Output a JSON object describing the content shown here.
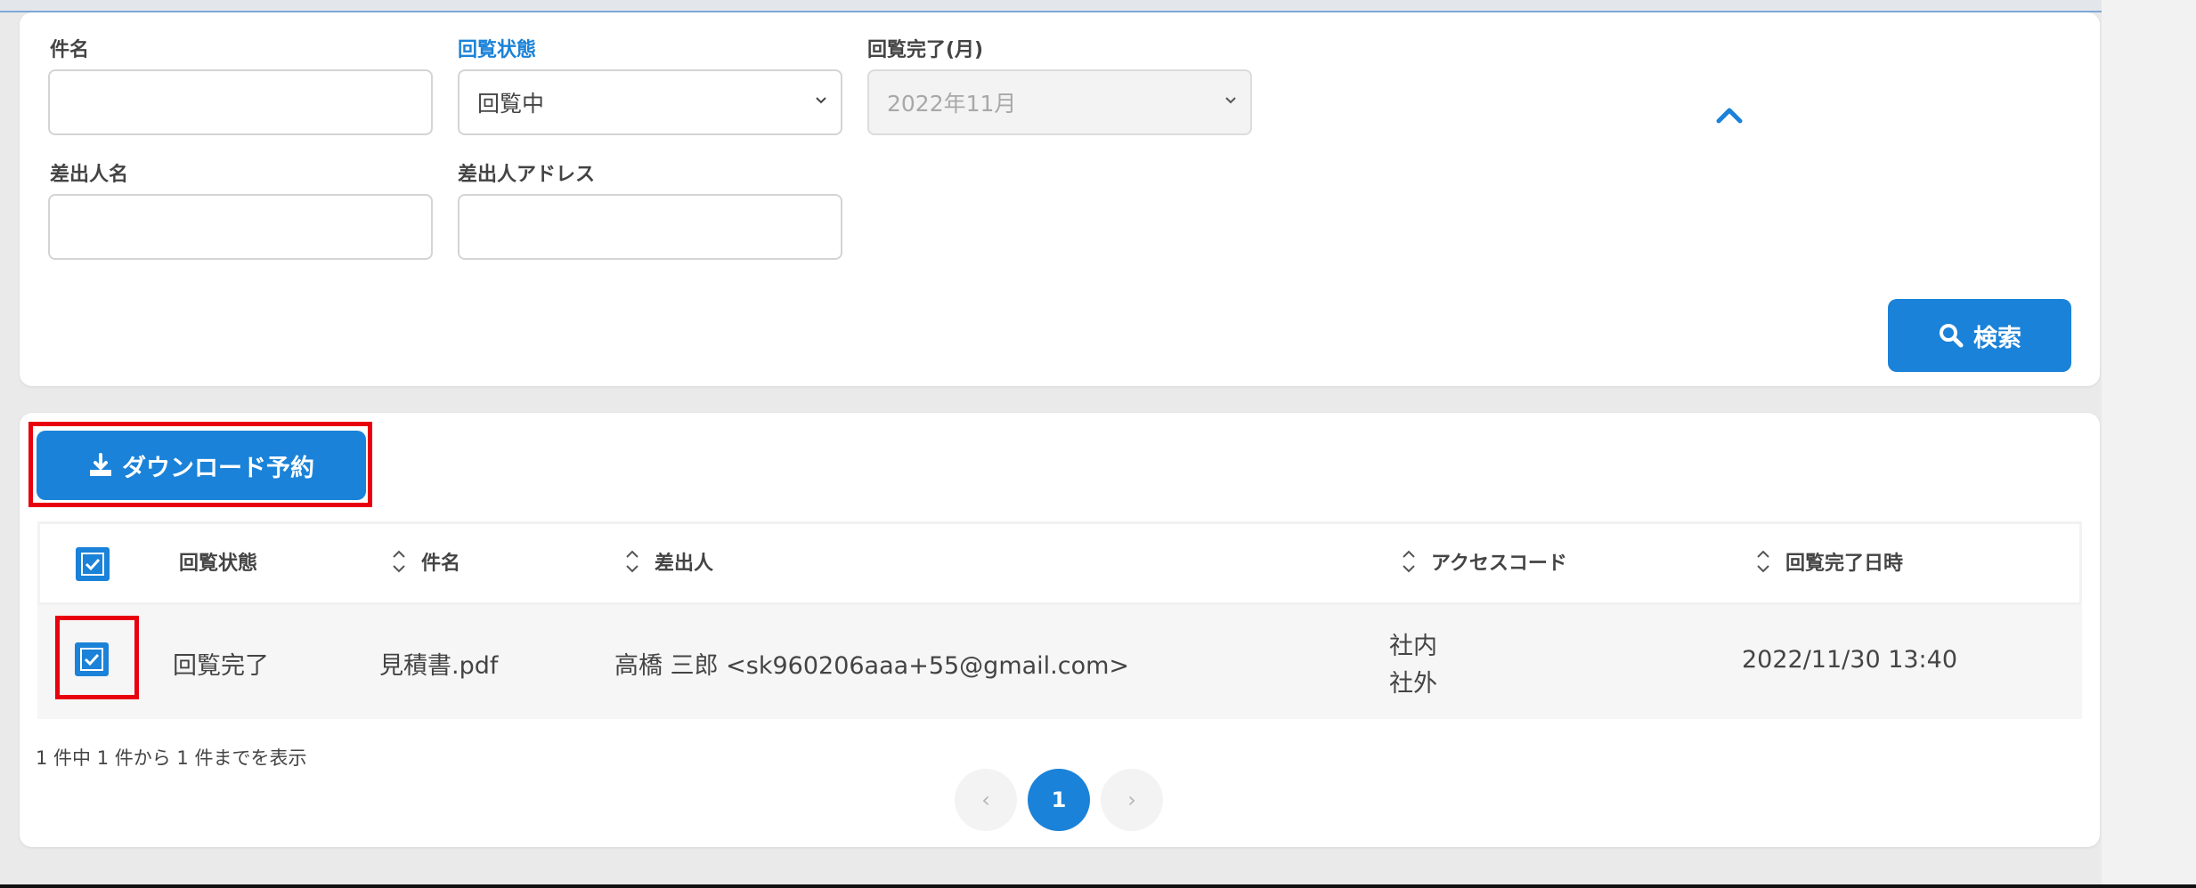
{
  "search": {
    "subject_label": "件名",
    "subject_value": "",
    "status_label": "回覧状態",
    "status_value": "回覧中",
    "completed_month_label": "回覧完了(月)",
    "completed_month_value": "2022年11月",
    "sender_name_label": "差出人名",
    "sender_name_value": "",
    "sender_address_label": "差出人アドレス",
    "sender_address_value": "",
    "search_button": "検索"
  },
  "results": {
    "download_button": "ダウンロード予約",
    "columns": [
      "回覧状態",
      "件名",
      "差出人",
      "アクセスコード",
      "回覧完了日時"
    ],
    "rows": [
      {
        "status": "回覧完了",
        "subject": "見積書.pdf",
        "sender": "高橋 三郎 <sk960206aaa+55@gmail.com>",
        "access_code": [
          "社内",
          "社外"
        ],
        "completed_at": "2022/11/30 13:40"
      }
    ],
    "summary": "1 件中 1 件から 1 件までを表示",
    "pagination": {
      "prev": "‹",
      "current": "1",
      "next": "›"
    }
  },
  "colors": {
    "accent": "#1a82d8",
    "highlight": "#e8000f"
  }
}
